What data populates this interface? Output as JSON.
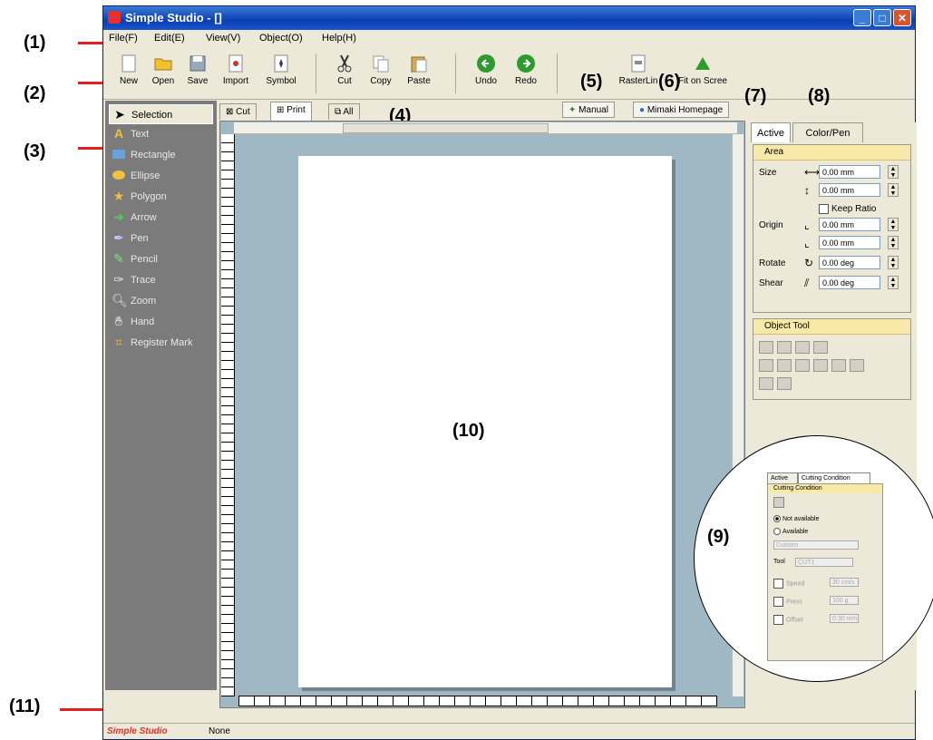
{
  "callouts": {
    "c1": "(1)",
    "c2": "(2)",
    "c3": "(3)",
    "c4": "(4)",
    "c5": "(5)",
    "c6": "(6)",
    "c7": "(7)",
    "c8": "(8)",
    "c9": "(9)",
    "c10": "(10)",
    "c11": "(11)"
  },
  "window": {
    "title": "Simple Studio - []",
    "minimize": "_",
    "maximize": "□",
    "close": "✕"
  },
  "menubar": [
    "File(F)",
    "Edit(E)",
    "View(V)",
    "Object(O)",
    "Help(H)"
  ],
  "toolbar": {
    "buttons": [
      "New",
      "Open",
      "Save",
      "Import",
      "Symbol",
      "Cut",
      "Copy",
      "Paste",
      "Undo",
      "Redo",
      "RasterLin",
      "Fit on Scree"
    ]
  },
  "toolbox": {
    "tools": [
      "Selection",
      "Text",
      "Rectangle",
      "Ellipse",
      "Polygon",
      "Arrow",
      "Pen",
      "Pencil",
      "Trace",
      "Zoom",
      "Hand",
      "Register Mark"
    ]
  },
  "doc_tabs": [
    "Cut",
    "Print",
    "All"
  ],
  "links": {
    "manual": "Manual",
    "homepage": "Mimaki Homepage"
  },
  "panel": {
    "tabs": [
      "Active",
      "Color/Pen"
    ],
    "area": {
      "title": "Area",
      "size_label": "Size",
      "width": "0.00 mm",
      "height": "0.00 mm",
      "keep_ratio": "Keep Ratio",
      "origin_label": "Origin",
      "origin_x": "0.00 mm",
      "origin_y": "0.00 mm",
      "rotate_label": "Rotate",
      "rotate": "0.00 deg",
      "shear_label": "Shear",
      "shear": "0.00 deg"
    },
    "object_tool": {
      "title": "Object Tool"
    }
  },
  "zoom_inset": {
    "tabs": [
      "Active",
      "Cutting Condition"
    ],
    "title": "Cutting Condition",
    "not_available": "Not available",
    "available": "Available",
    "preset": "Custom",
    "tool_label": "Tool",
    "tool_value": "CUT1",
    "speed_label": "Speed",
    "speed_value": "30 cm/s",
    "press_label": "Press",
    "press_value": "100 g",
    "offset_label": "Offset",
    "offset_value": "0.30 mm"
  },
  "statusbar": {
    "app": "Simple Studio",
    "status": "None"
  }
}
